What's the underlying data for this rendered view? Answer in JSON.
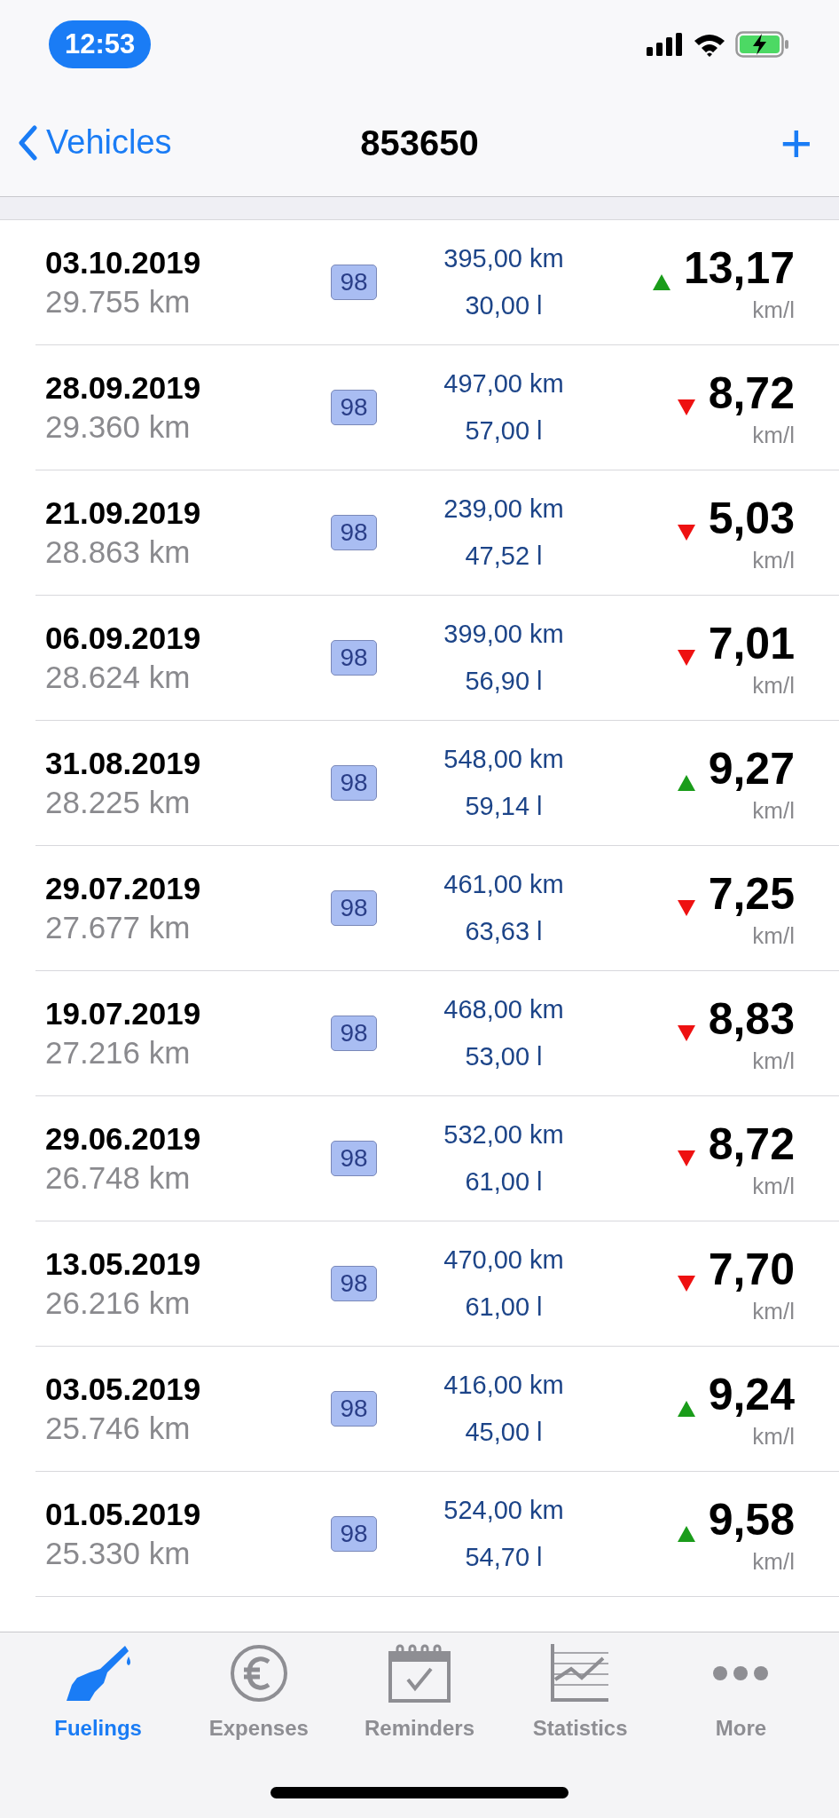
{
  "status_bar": {
    "time": "12:53"
  },
  "nav": {
    "back": "Vehicles",
    "title": "853650",
    "add": "+"
  },
  "rows": [
    {
      "date": "03.10.2019",
      "odometer": "29.755 km",
      "fuel": "98",
      "distance": "395,00 km",
      "volume": "30,00 l",
      "improved": true,
      "consumption": "13,17",
      "unit": "km/l"
    },
    {
      "date": "28.09.2019",
      "odometer": "29.360 km",
      "fuel": "98",
      "distance": "497,00 km",
      "volume": "57,00 l",
      "improved": false,
      "consumption": "8,72",
      "unit": "km/l"
    },
    {
      "date": "21.09.2019",
      "odometer": "28.863 km",
      "fuel": "98",
      "distance": "239,00 km",
      "volume": "47,52 l",
      "improved": false,
      "consumption": "5,03",
      "unit": "km/l"
    },
    {
      "date": "06.09.2019",
      "odometer": "28.624 km",
      "fuel": "98",
      "distance": "399,00 km",
      "volume": "56,90 l",
      "improved": false,
      "consumption": "7,01",
      "unit": "km/l"
    },
    {
      "date": "31.08.2019",
      "odometer": "28.225 km",
      "fuel": "98",
      "distance": "548,00 km",
      "volume": "59,14 l",
      "improved": true,
      "consumption": "9,27",
      "unit": "km/l"
    },
    {
      "date": "29.07.2019",
      "odometer": "27.677 km",
      "fuel": "98",
      "distance": "461,00 km",
      "volume": "63,63 l",
      "improved": false,
      "consumption": "7,25",
      "unit": "km/l"
    },
    {
      "date": "19.07.2019",
      "odometer": "27.216 km",
      "fuel": "98",
      "distance": "468,00 km",
      "volume": "53,00 l",
      "improved": false,
      "consumption": "8,83",
      "unit": "km/l"
    },
    {
      "date": "29.06.2019",
      "odometer": "26.748 km",
      "fuel": "98",
      "distance": "532,00 km",
      "volume": "61,00 l",
      "improved": false,
      "consumption": "8,72",
      "unit": "km/l"
    },
    {
      "date": "13.05.2019",
      "odometer": "26.216 km",
      "fuel": "98",
      "distance": "470,00 km",
      "volume": "61,00 l",
      "improved": false,
      "consumption": "7,70",
      "unit": "km/l"
    },
    {
      "date": "03.05.2019",
      "odometer": "25.746 km",
      "fuel": "98",
      "distance": "416,00 km",
      "volume": "45,00 l",
      "improved": true,
      "consumption": "9,24",
      "unit": "km/l"
    },
    {
      "date": "01.05.2019",
      "odometer": "25.330 km",
      "fuel": "98",
      "distance": "524,00 km",
      "volume": "54,70 l",
      "improved": true,
      "consumption": "9,58",
      "unit": "km/l"
    }
  ],
  "tabs": [
    {
      "kind": "fuel",
      "label": "Fuelings",
      "selected": true
    },
    {
      "kind": "euro",
      "label": "Expenses",
      "selected": false
    },
    {
      "kind": "calendar",
      "label": "Reminders",
      "selected": false
    },
    {
      "kind": "chart",
      "label": "Statistics",
      "selected": false
    },
    {
      "kind": "more",
      "label": "More",
      "selected": false
    }
  ]
}
